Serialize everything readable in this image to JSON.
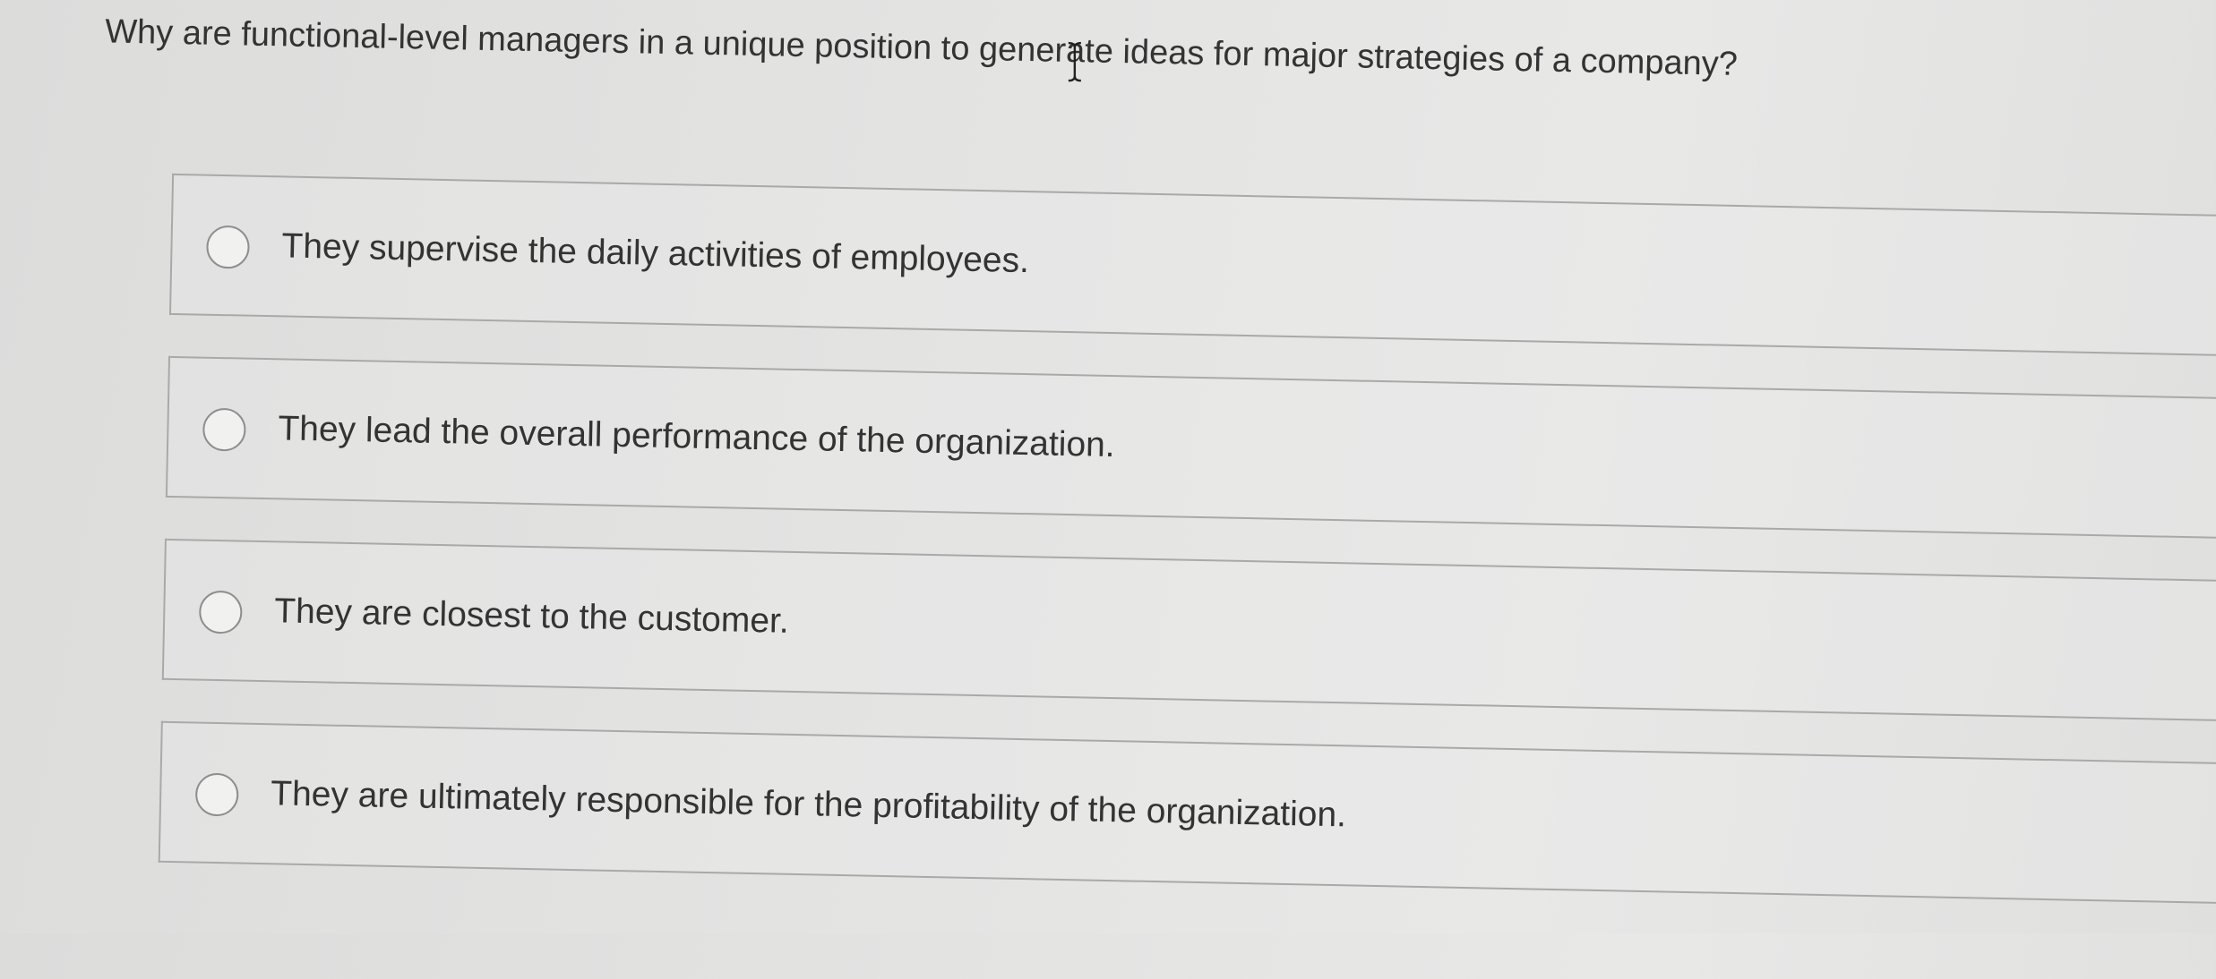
{
  "question": {
    "text": "Why are functional-level managers in a unique position to generate ideas for major strategies of a company?"
  },
  "options": [
    {
      "label": "They supervise the daily activities of employees."
    },
    {
      "label": "They lead the overall performance of the organization."
    },
    {
      "label": "They are closest to the customer."
    },
    {
      "label": "They are ultimately responsible for the profitability of the organization."
    }
  ],
  "icons": {
    "cursor": "text-cursor-icon",
    "radio": "radio-button-icon"
  }
}
